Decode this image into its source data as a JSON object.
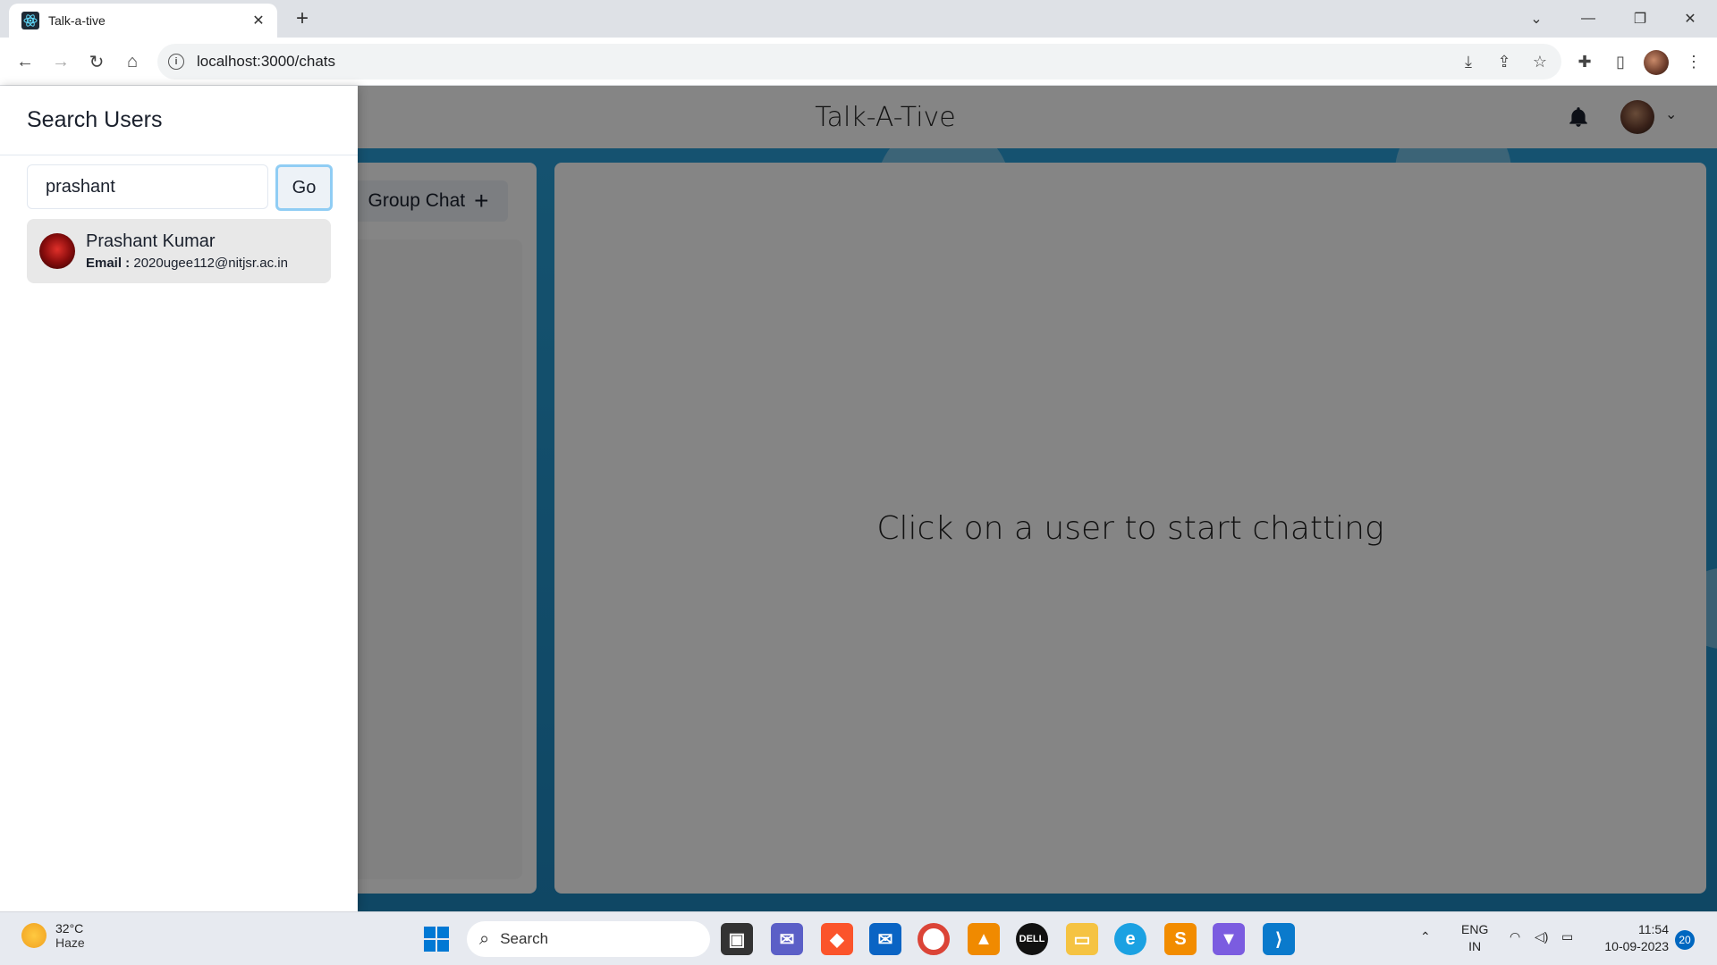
{
  "browser": {
    "tab_title": "Talk-a-tive",
    "url": "localhost:3000/chats"
  },
  "app": {
    "title": "Talk-A-Tive",
    "group_chat_label": "Group Chat",
    "empty_chat_message": "Click on a user to start chatting"
  },
  "drawer": {
    "title": "Search Users",
    "search_value": "prashant",
    "go_label": "Go",
    "results": [
      {
        "name": "Prashant Kumar",
        "email_label": "Email :",
        "email": "2020ugee112@nitjsr.ac.in"
      }
    ]
  },
  "taskbar": {
    "temperature": "32°C",
    "condition": "Haze",
    "search_placeholder": "Search",
    "language": "ENG",
    "region": "IN",
    "time": "11:54",
    "date": "10-09-2023",
    "notifications": "20"
  },
  "colors": {
    "page_background": "#1e88c0",
    "go_button_border": "#90cdf4",
    "notification_badge": "#0067c0"
  }
}
